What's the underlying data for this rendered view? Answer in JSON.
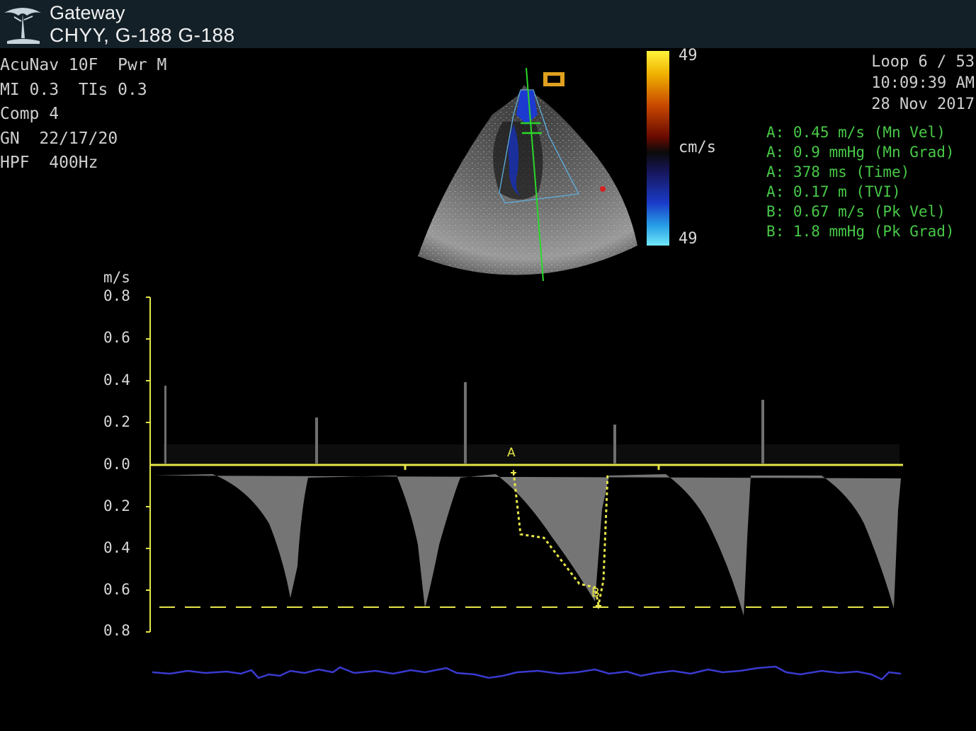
{
  "header": {
    "app_name": "Gateway",
    "patient": "CHYY, G-188 G-188"
  },
  "params": [
    "AcuNav 10F  Pwr M",
    "MI 0.3  TIs 0.3",
    "Comp 4",
    "GN  22/17/20",
    "HPF  400Hz"
  ],
  "loop": {
    "counter": "Loop 6 / 53",
    "time": "10:09:39 AM",
    "date": "28 Nov 2017"
  },
  "measurements": [
    "A: 0.45 m/s (Mn Vel)",
    "A: 0.9 mmHg (Mn Grad)",
    "A: 378 ms (Time)",
    "A: 0.17 m (TVI)",
    "B: 0.67 m/s (Pk Vel)",
    "B: 1.8 mmHg (Pk Grad)"
  ],
  "color_scale": {
    "top": "49",
    "bottom": "49",
    "unit": "cm/s"
  },
  "orientation_marker": "icon-orientation-marker",
  "doppler": {
    "unit": "m/s",
    "ticks": [
      "0.8",
      "0.6",
      "0.4",
      "0.2",
      "0.0",
      "0.2",
      "0.4",
      "0.6",
      "0.8"
    ],
    "markers": [
      "A",
      "B"
    ]
  },
  "colors": {
    "measurement_text": "#48c848",
    "baseline": "#e6e64a",
    "ecg": "#3a3ad0",
    "titlebar": "#132028"
  }
}
